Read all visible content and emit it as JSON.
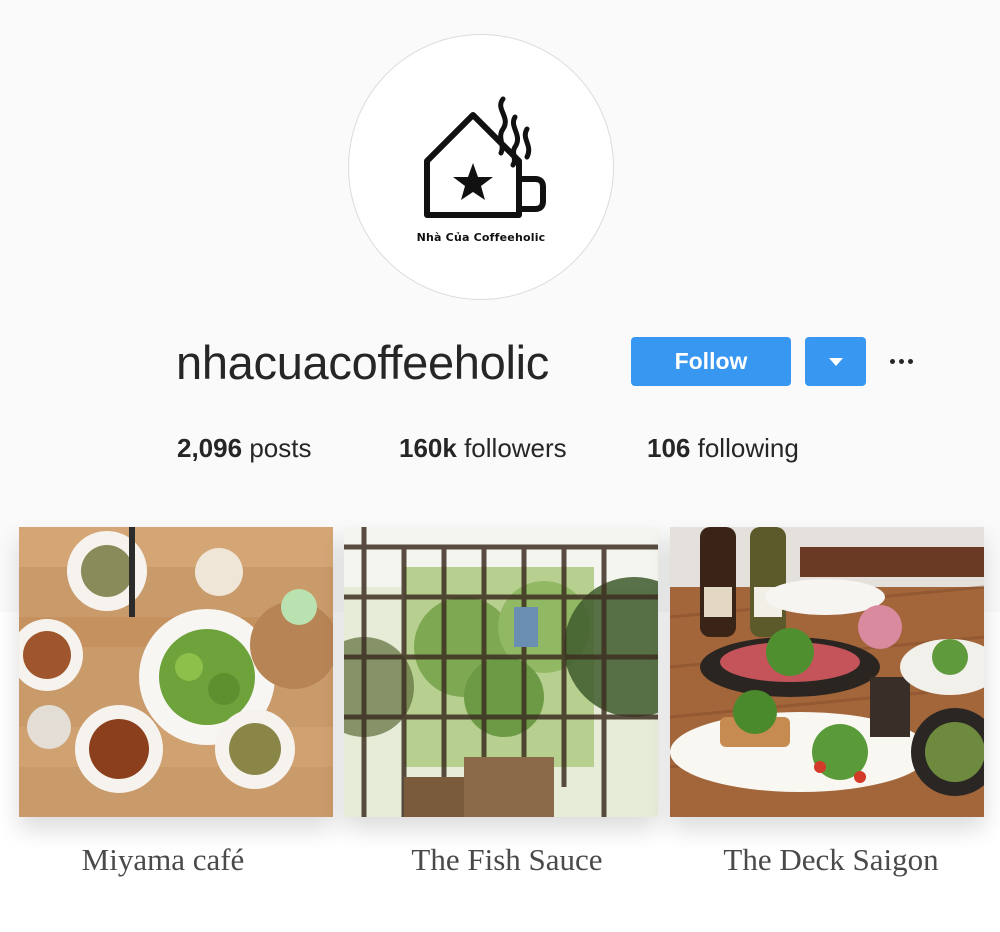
{
  "profile": {
    "logo_text": "Nhà Của Coffeeholic",
    "username": "nhacuacoffeeholic",
    "follow_label": "Follow"
  },
  "stats": {
    "posts_count": "2,096",
    "posts_label": "posts",
    "followers_count": "160k",
    "followers_label": "followers",
    "following_count": "106",
    "following_label": "following"
  },
  "places": [
    {
      "caption": "Miyama café"
    },
    {
      "caption": "The Fish Sauce"
    },
    {
      "caption": "The Deck Saigon"
    }
  ],
  "colors": {
    "accent": "#3897f0",
    "background": "#fafafa"
  }
}
